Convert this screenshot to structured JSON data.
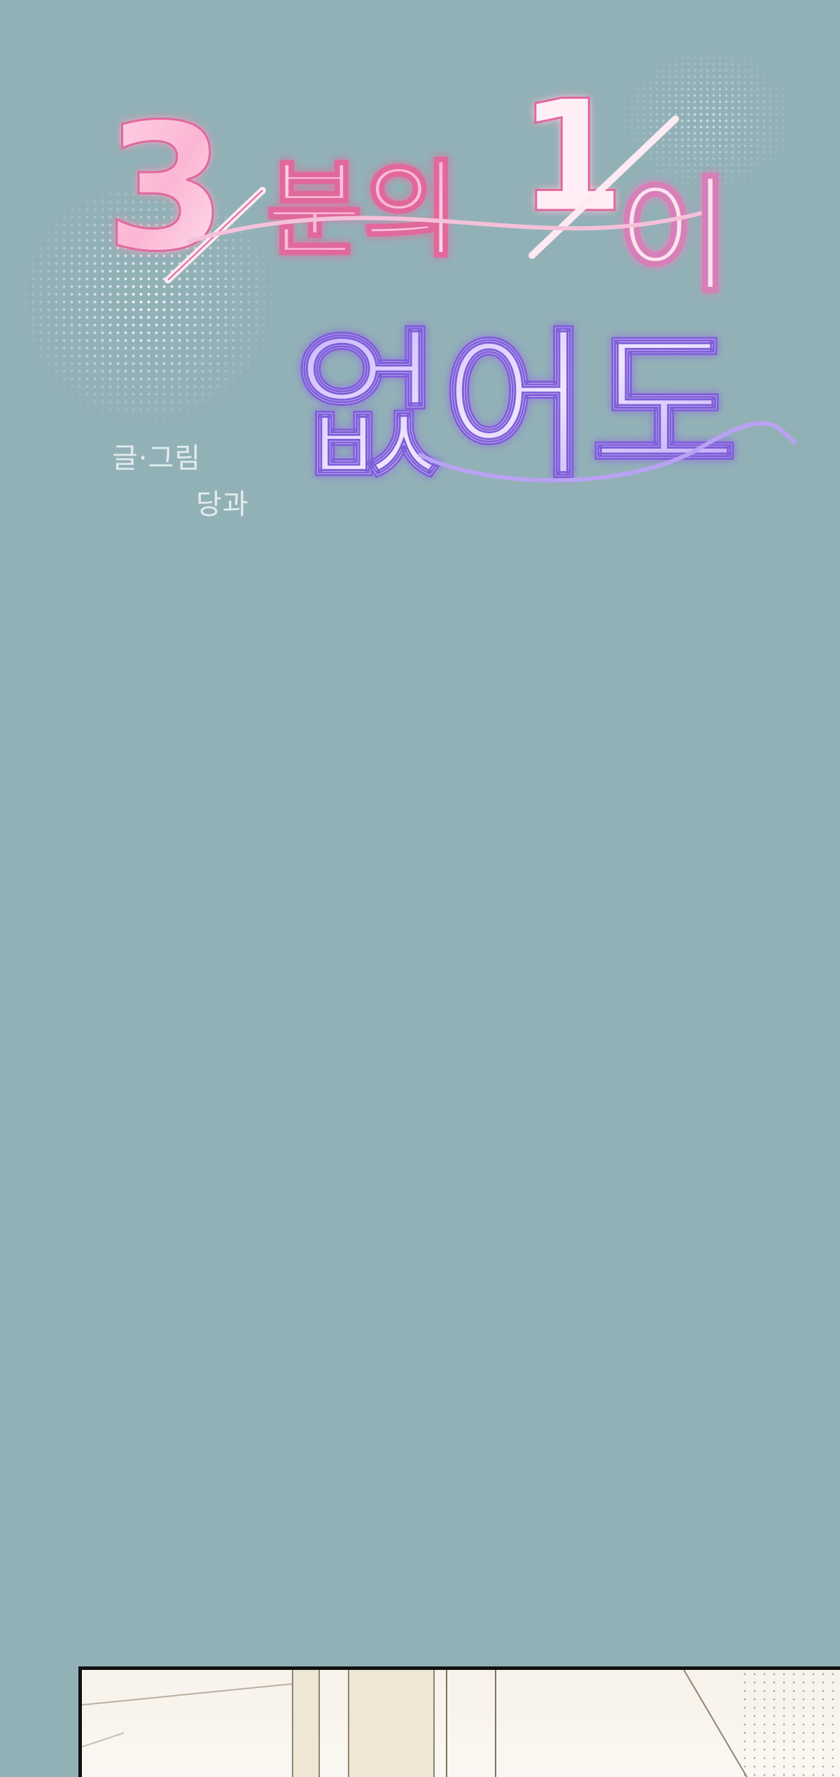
{
  "title": {
    "line1_numeral": "3",
    "line1_word1": "분의",
    "line1_numeral2": "1",
    "line1_word2": "이",
    "line2": "없어도"
  },
  "credits": {
    "role": "글·그림",
    "author": "당과"
  },
  "colors": {
    "background": "#92b1b7",
    "title_pink": "#f7a9c9",
    "title_purple": "#b59bf3",
    "credit_text": "#e2ebee"
  }
}
